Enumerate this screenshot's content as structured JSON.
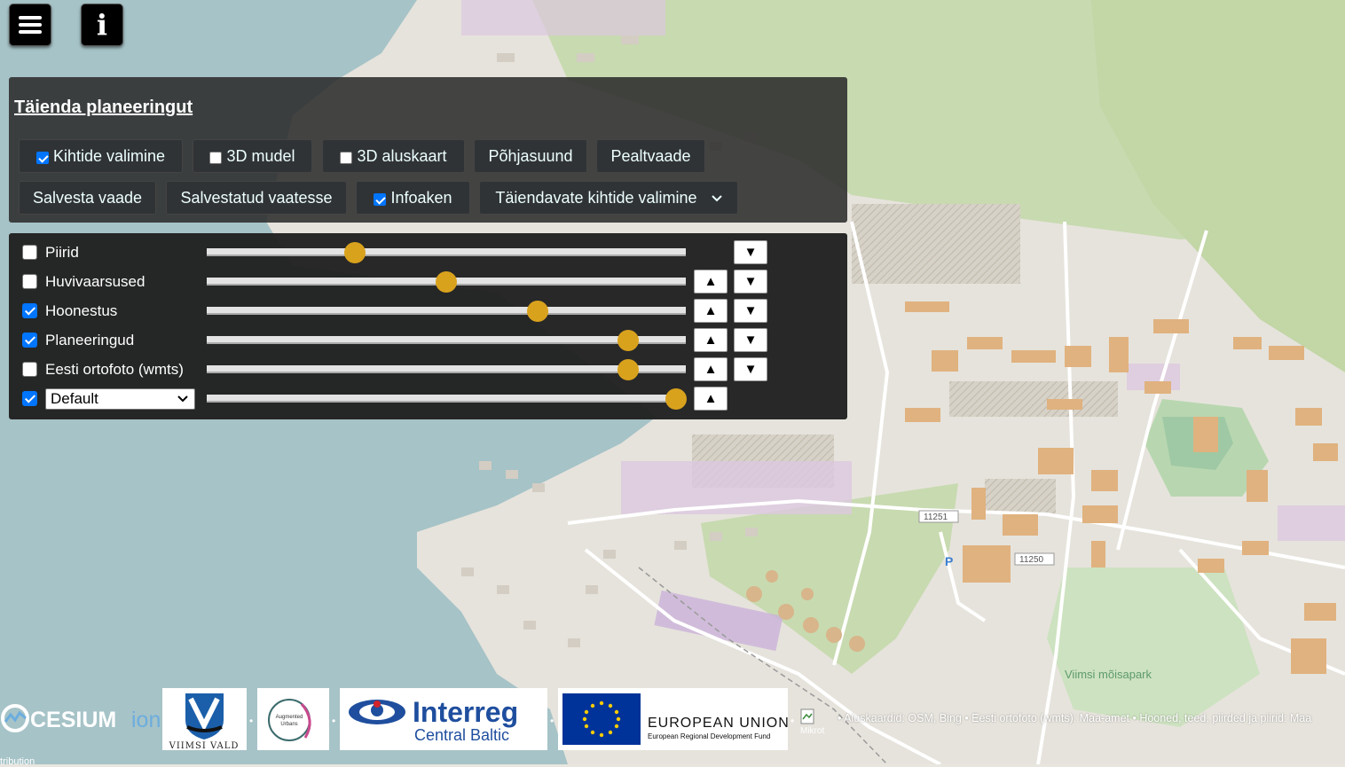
{
  "top_buttons": {
    "menu_icon": "hamburger-icon",
    "info_icon": "info-icon",
    "info_glyph": "i"
  },
  "toolbar": {
    "title": "Täienda planeeringut",
    "buttons": [
      {
        "label": "Kihtide valimine",
        "checkbox": true,
        "checked": true
      },
      {
        "label": "3D mudel",
        "checkbox": true,
        "checked": false
      },
      {
        "label": "3D aluskaart",
        "checkbox": true,
        "checked": false
      },
      {
        "label": "Põhjasuund"
      },
      {
        "label": "Pealtvaade"
      },
      {
        "label": "Salvesta vaade"
      },
      {
        "label": "Salvestatud vaatesse"
      },
      {
        "label": "Infoaken",
        "checkbox": true,
        "checked": true
      },
      {
        "label": "Täiendavate kihtide valimine",
        "dropdown": true
      }
    ]
  },
  "layers": [
    {
      "name": "Piirid",
      "checked": false,
      "opacity": 0.31
    },
    {
      "name": "Huvivaarsused",
      "checked": false,
      "opacity": 0.5
    },
    {
      "name": "Hoonestus",
      "checked": true,
      "opacity": 0.69
    },
    {
      "name": "Planeeringud",
      "checked": true,
      "opacity": 0.88
    },
    {
      "name": "Eesti ortofoto (wmts)",
      "checked": false,
      "opacity": 0.88
    },
    {
      "name": "Default",
      "checked": true,
      "opacity": 0.98,
      "select": true
    }
  ],
  "order_buttons": {
    "up": "▲",
    "down": "▼"
  },
  "footer": {
    "cesium_text": "CESIUM",
    "cesium_ion": "ion",
    "viimsi": "VIIMSI VALD",
    "augmented_line1": "Augmented",
    "augmented_line2": "Urbans",
    "interreg": "Interreg",
    "central_baltic": "Central Baltic",
    "eu_title": "EUROPEAN UNION",
    "eu_sub": "European Regional Development Fund",
    "separator": "•",
    "broken_img_alt": "Mikrot",
    "credits": "• Aluskaardid: OSM, Bing • Eesti ortofoto (wmts): Maa-amet • Hooned, teed, piirded ja piirid: Maa",
    "attribution": "ttribution"
  },
  "map_labels": {
    "park": "Viimsi mõisapark",
    "road1": "11251",
    "road2": "11250",
    "parking": "P"
  },
  "colors": {
    "accent": "#d9a21d",
    "checkbox": "#0075ff",
    "water": "#a6c3c7",
    "land": "#e6e3dc",
    "green": "#c8dab0"
  }
}
